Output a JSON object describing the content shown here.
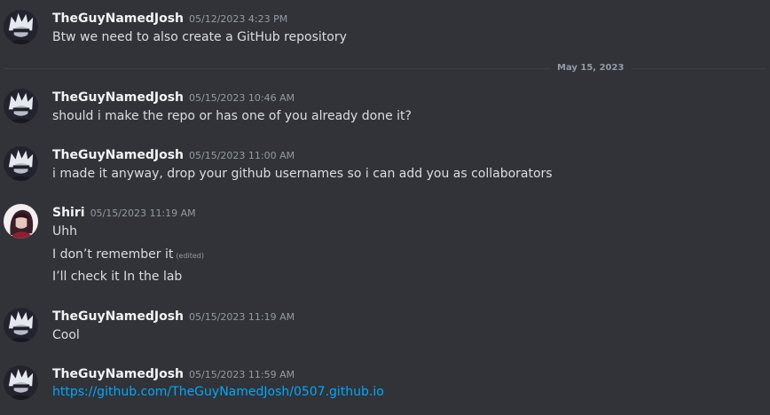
{
  "divider_date": "May 15, 2023",
  "messages": [
    {
      "username": "TheGuyNamedJosh",
      "timestamp": "05/12/2023 4:23 PM",
      "lines": [
        "Btw we need to also create a GitHub repository"
      ]
    },
    {
      "username": "TheGuyNamedJosh",
      "timestamp": "05/15/2023 10:46 AM",
      "lines": [
        "should i make the repo or has one of you already done it?"
      ]
    },
    {
      "username": "TheGuyNamedJosh",
      "timestamp": "05/15/2023 11:00 AM",
      "lines": [
        "i made it anyway, drop your github usernames so i can add you as collaborators"
      ]
    },
    {
      "username": "Shiri",
      "timestamp": "05/15/2023 11:19 AM",
      "lines": [
        "Uhh",
        "I don’t remember it",
        "I’ll check it In the lab"
      ],
      "edited_label": "(edited)"
    },
    {
      "username": "TheGuyNamedJosh",
      "timestamp": "05/15/2023 11:19 AM",
      "lines": [
        "Cool"
      ]
    },
    {
      "username": "TheGuyNamedJosh",
      "timestamp": "05/15/2023 11:59 AM",
      "lines": [
        "https://github.com/TheGuyNamedJosh/0507.github.io"
      ]
    }
  ],
  "colors": {
    "background": "#313338",
    "username": "#f2f3f5",
    "text": "#dbdee1",
    "muted": "#949ba4",
    "link": "#00a8fc"
  }
}
